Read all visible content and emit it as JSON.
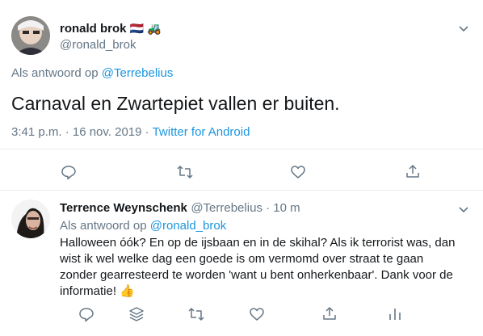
{
  "main_tweet": {
    "author_name": "ronald brok",
    "author_flags": "🇳🇱 🚜",
    "handle": "@ronald_brok",
    "reply_to_prefix": "Als antwoord op",
    "reply_to_handle": "@Terrebelius",
    "text": "Carnaval en Zwartepiet vallen er buiten.",
    "timestamp": "3:41 p.m. · 16 nov. 2019 · ",
    "source": "Twitter for Android"
  },
  "reply_tweet": {
    "author_name": "Terrence Weynschenk",
    "handle_time": "@Terrebelius · 10 m",
    "reply_to_prefix": "Als antwoord op",
    "reply_to_handle": "@ronald_brok",
    "text": "Halloween óók? En op de ijsbaan en in de skihal? Als ik terrorist was, dan wist ik wel welke dag een goede is om vermomd over straat te gaan zonder gearresteerd te worden 'want u bent onherkenbaar'. Dank voor de informatie! 👍"
  },
  "colors": {
    "accent": "#1b95e0",
    "muted": "#657786",
    "divider": "#e6ecf0"
  },
  "icons": [
    "chevron-down-icon",
    "reply-icon",
    "retweet-icon",
    "like-icon",
    "share-icon",
    "stack-icon",
    "analytics-icon"
  ]
}
